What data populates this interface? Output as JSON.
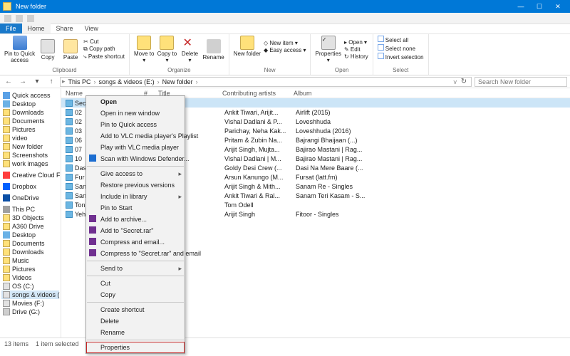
{
  "window": {
    "title": "New folder"
  },
  "tabs": {
    "file": "File",
    "home": "Home",
    "share": "Share",
    "view": "View"
  },
  "ribbon": {
    "clipboard": {
      "pin1": "Pin to Quick",
      "pin2": "access",
      "copy": "Copy",
      "paste": "Paste",
      "cut": "Cut",
      "copypath": "Copy path",
      "pasteshort": "Paste shortcut",
      "label": "Clipboard"
    },
    "organize": {
      "moveto": "Move to",
      "copyto": "Copy to",
      "delete": "Delete",
      "rename": "Rename",
      "label": "Organize"
    },
    "new": {
      "folder": "New folder",
      "item": "New item",
      "easy": "Easy access",
      "label": "New"
    },
    "open": {
      "props": "Properties",
      "open": "Open",
      "edit": "Edit",
      "history": "History",
      "label": "Open"
    },
    "select": {
      "all": "Select all",
      "none": "Select none",
      "inv": "Invert selection",
      "label": "Select"
    }
  },
  "breadcrumb": {
    "thispc": "This PC",
    "drive": "songs & videos (E:)",
    "folder": "New folder"
  },
  "search": {
    "placeholder": "Search New folder"
  },
  "tree": {
    "items": [
      {
        "icon": "tf-star",
        "label": "Quick access"
      },
      {
        "icon": "tf-desk",
        "label": "Desktop"
      },
      {
        "icon": "tf-fold",
        "label": "Downloads"
      },
      {
        "icon": "tf-fold",
        "label": "Documents"
      },
      {
        "icon": "tf-fold",
        "label": "Pictures"
      },
      {
        "icon": "tf-fold",
        "label": "video"
      },
      {
        "icon": "tf-fold",
        "label": "New folder"
      },
      {
        "icon": "tf-fold",
        "label": "Screenshots"
      },
      {
        "icon": "tf-fold",
        "label": "work images"
      },
      {
        "icon": "",
        "label": ""
      },
      {
        "icon": "tf-cc",
        "label": "Creative Cloud Fil"
      },
      {
        "icon": "",
        "label": ""
      },
      {
        "icon": "tf-db",
        "label": "Dropbox"
      },
      {
        "icon": "",
        "label": ""
      },
      {
        "icon": "tf-od",
        "label": "OneDrive"
      },
      {
        "icon": "",
        "label": ""
      },
      {
        "icon": "tf-pc",
        "label": "This PC"
      },
      {
        "icon": "tf-fold",
        "label": "3D Objects"
      },
      {
        "icon": "tf-fold",
        "label": "A360 Drive"
      },
      {
        "icon": "tf-desk",
        "label": "Desktop"
      },
      {
        "icon": "tf-fold",
        "label": "Documents"
      },
      {
        "icon": "tf-fold",
        "label": "Downloads"
      },
      {
        "icon": "tf-fold",
        "label": "Music"
      },
      {
        "icon": "tf-fold",
        "label": "Pictures"
      },
      {
        "icon": "tf-fold",
        "label": "Videos"
      },
      {
        "icon": "tf-dr",
        "label": "OS (C:)"
      },
      {
        "icon": "tf-dr",
        "label": "songs & videos ("
      },
      {
        "icon": "tf-dr",
        "label": "Movies (F:)"
      },
      {
        "icon": "tf-dr2",
        "label": "Drive (G:)"
      }
    ],
    "selected_index": 26
  },
  "columns": {
    "name": "Name",
    "num": "#",
    "title": "Title",
    "contrib": "Contributing artists",
    "album": "Album"
  },
  "files": [
    {
      "name": "Secret",
      "ca": "",
      "al": ""
    },
    {
      "name": "02",
      "ca": "Ankit Tiwari, Arijit...",
      "al": "Airlift (2015)"
    },
    {
      "name": "02",
      "ca": "Vishal Dadlani & P...",
      "al": "Loveshhuda"
    },
    {
      "name": "03",
      "ca": "Parichay, Neha Kak...",
      "al": "Loveshhuda (2016)"
    },
    {
      "name": "06",
      "ca": "Pritam & Zubin Na...",
      "al": "Bajrangi Bhaijaan (...)"
    },
    {
      "name": "07",
      "ca": "Arijit Singh, Mujta...",
      "al": "Bajirao Mastani | Rag..."
    },
    {
      "name": "10",
      "ca": "Vishal Dadlani | M...",
      "al": "Bajirao Mastani | Rag..."
    },
    {
      "name": "Das",
      "ca": "Goldy Desi Crew (...",
      "al": "Dasi Na Mere Baare (..."
    },
    {
      "name": "Fur",
      "ca": "Arsun Kanungo (M...",
      "al": "Fursat (latt.fm)"
    },
    {
      "name": "San",
      "ca": "Arijit Singh & Mith...",
      "al": "Sanam Re - Singles"
    },
    {
      "name": "San",
      "ca": "Ankit Tiwari & Ral...",
      "al": "Sanam Teri Kasam - S..."
    },
    {
      "name": "Ton",
      "ca": "Tom Odell",
      "al": ""
    },
    {
      "name": "Yeh",
      "ca": "Arijit Singh",
      "al": "Fitoor - Singles"
    }
  ],
  "contextmenu": {
    "open": "Open",
    "newwin": "Open in new window",
    "pinqa": "Pin to Quick access",
    "vlcpl": "Add to VLC media player's Playlist",
    "vlcplay": "Play with VLC media player",
    "defender": "Scan with Windows Defender...",
    "giveacc": "Give access to",
    "restore": "Restore previous versions",
    "inclib": "Include in library",
    "pinstart": "Pin to Start",
    "addarch": "Add to archive...",
    "addrar": "Add to \"Secret.rar\"",
    "compemail": "Compress and email...",
    "comprar": "Compress to \"Secret.rar\" and email",
    "sendto": "Send to",
    "cut": "Cut",
    "copy": "Copy",
    "shortcut": "Create shortcut",
    "delete": "Delete",
    "rename": "Rename",
    "properties": "Properties"
  },
  "status": {
    "count": "13 items",
    "sel": "1 item selected"
  }
}
